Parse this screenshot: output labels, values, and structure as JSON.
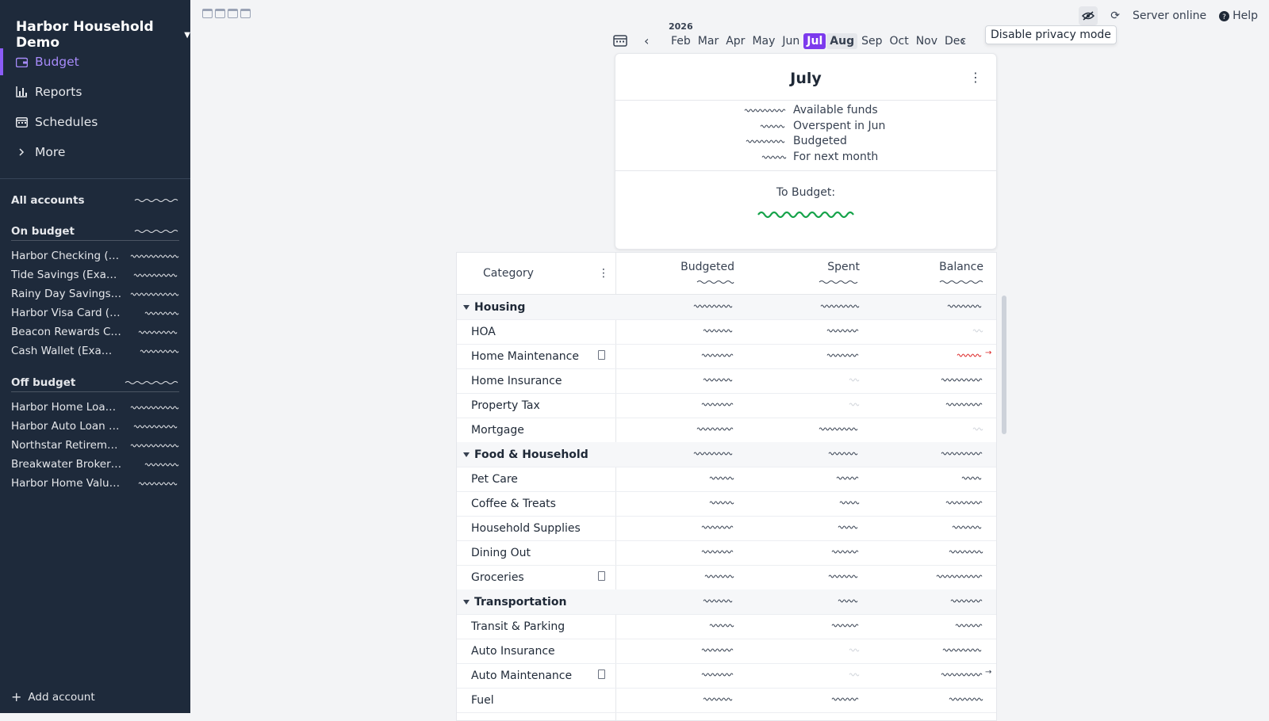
{
  "sidebar": {
    "budget_name": "Harbor Household Demo",
    "nav": [
      {
        "label": "Budget",
        "icon": "wallet-icon"
      },
      {
        "label": "Reports",
        "icon": "bar-chart-icon"
      },
      {
        "label": "Schedules",
        "icon": "calendar-icon"
      },
      {
        "label": "More",
        "icon": "chevron-right-icon"
      }
    ],
    "all_accounts": "All accounts",
    "on_budget": "On budget",
    "on_budget_accounts": [
      "Harbor Checking (Example)",
      "Tide Savings (Example)",
      "Rainy Day Savings (Example)",
      "Harbor Visa Card (Example)",
      "Beacon Rewards Card (Example)",
      "Cash Wallet (Example)"
    ],
    "off_budget": "Off budget",
    "off_budget_accounts": [
      "Harbor Home Loan (Example)",
      "Harbor Auto Loan (Example)",
      "Northstar Retirement (Example)",
      "Breakwater Brokerage (Example)",
      "Harbor Home Value (Example)"
    ],
    "add_account": "Add account"
  },
  "topbar": {
    "privacy_tooltip": "Disable privacy mode",
    "server_status": "Server online",
    "help": "Help"
  },
  "month_nav": {
    "year": "2026",
    "months": [
      "Feb",
      "Mar",
      "Apr",
      "May",
      "Jun",
      "Jul",
      "Aug",
      "Sep",
      "Oct",
      "Nov",
      "Dec"
    ],
    "selected": "Jul",
    "next": "Aug"
  },
  "summary": {
    "title": "July",
    "rows": [
      "Available funds",
      "Overspent in Jun",
      "Budgeted",
      "For next month"
    ],
    "to_budget_label": "To Budget:"
  },
  "table": {
    "category_header": "Category",
    "columns": [
      "Budgeted",
      "Spent",
      "Balance"
    ],
    "rows": [
      {
        "type": "group",
        "name": "Housing"
      },
      {
        "type": "item",
        "name": "HOA"
      },
      {
        "type": "item",
        "name": "Home Maintenance",
        "note": true,
        "balance": "negative"
      },
      {
        "type": "item",
        "name": "Home Insurance"
      },
      {
        "type": "item",
        "name": "Property Tax"
      },
      {
        "type": "item",
        "name": "Mortgage"
      },
      {
        "type": "group",
        "name": "Food & Household"
      },
      {
        "type": "item",
        "name": "Pet Care"
      },
      {
        "type": "item",
        "name": "Coffee & Treats"
      },
      {
        "type": "item",
        "name": "Household Supplies"
      },
      {
        "type": "item",
        "name": "Dining Out"
      },
      {
        "type": "item",
        "name": "Groceries",
        "note": true
      },
      {
        "type": "group",
        "name": "Transportation"
      },
      {
        "type": "item",
        "name": "Transit & Parking"
      },
      {
        "type": "item",
        "name": "Auto Insurance"
      },
      {
        "type": "item",
        "name": "Auto Maintenance",
        "note": true,
        "balance": "carryover"
      },
      {
        "type": "item",
        "name": "Fuel"
      }
    ]
  },
  "colors": {
    "sidebar_bg": "#1e2a3b",
    "accent": "#7c3aed",
    "positive_to_budget": "#16a34a",
    "overspent": "#dc2626"
  }
}
